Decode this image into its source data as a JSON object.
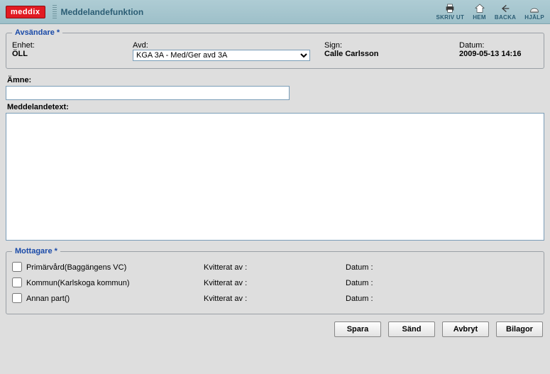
{
  "header": {
    "logo": "meddix",
    "title": "Meddelandefunktion",
    "tools": {
      "print": "SKRIV UT",
      "home": "HEM",
      "back": "BACKA",
      "help": "HJÄLP"
    }
  },
  "sender": {
    "legend": "Avsändare *",
    "enhet_label": "Enhet:",
    "enhet_value": "ÖLL",
    "avd_label": "Avd:",
    "avd_value": "KGA 3A - Med/Ger avd 3A",
    "sign_label": "Sign:",
    "sign_value": "Calle Carlsson",
    "date_label": "Datum:",
    "date_value": "2009-05-13 14:16"
  },
  "subject": {
    "label": "Ämne:",
    "value": ""
  },
  "message": {
    "label": "Meddelandetext:",
    "value": ""
  },
  "recipients": {
    "legend": "Mottagare *",
    "rows": [
      {
        "name": "Primärvård(Baggängens VC)",
        "kv": "Kvitterat av :",
        "dt": "Datum :"
      },
      {
        "name": "Kommun(Karlskoga kommun)",
        "kv": "Kvitterat av :",
        "dt": "Datum :"
      },
      {
        "name": "Annan part()",
        "kv": "Kvitterat av :",
        "dt": "Datum :"
      }
    ]
  },
  "buttons": {
    "save": "Spara",
    "send": "Sänd",
    "cancel": "Avbryt",
    "attach": "Bilagor"
  }
}
